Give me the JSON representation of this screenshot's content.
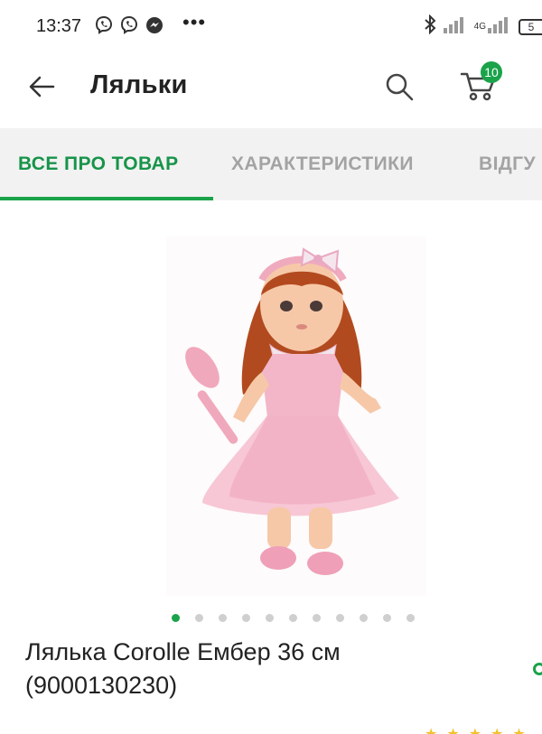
{
  "status_bar": {
    "time": "13:37",
    "icons_left": [
      "viber-icon",
      "viber-icon",
      "messenger-icon"
    ],
    "more": "•••",
    "network": "4G",
    "battery": "5"
  },
  "app_bar": {
    "title": "Ляльки",
    "cart_count": "10"
  },
  "tabs": [
    {
      "label": "ВСЕ ПРО ТОВАР",
      "active": true
    },
    {
      "label": "ХАРАКТЕРИСТИКИ",
      "active": false
    },
    {
      "label": "ВІДГУ",
      "active": false
    }
  ],
  "product": {
    "title": "Лялька Corolle Ембер 36 см",
    "code": "(9000130230)"
  },
  "carousel": {
    "count": 11,
    "active_index": 0
  },
  "colors": {
    "accent": "#1aa34a",
    "tab_active": "#17944a",
    "tab_inactive": "#a3a3a3"
  }
}
